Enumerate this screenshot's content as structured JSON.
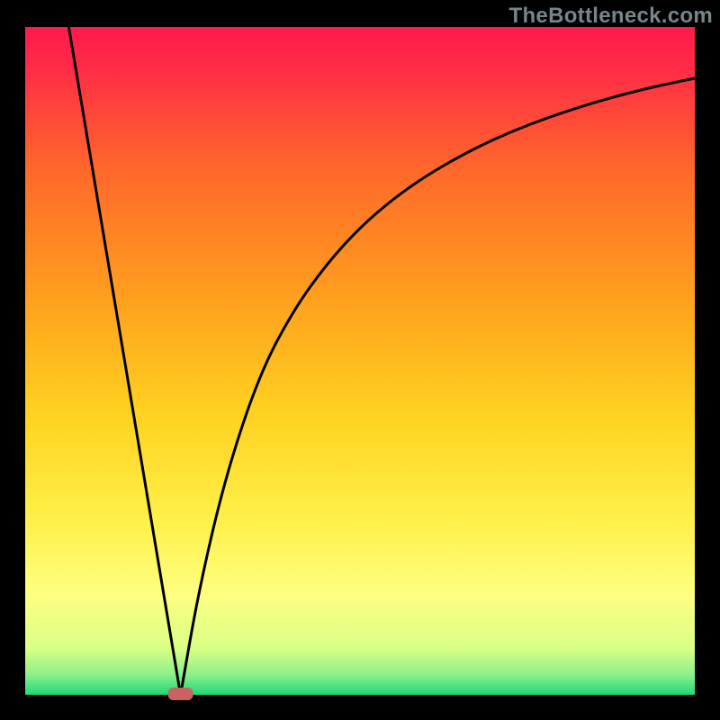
{
  "watermark": "TheBottleneck.com",
  "chart_data": {
    "type": "line",
    "title": "",
    "xlabel": "",
    "ylabel": "",
    "xlim": [
      0,
      100
    ],
    "ylim": [
      0,
      100
    ],
    "series": [
      {
        "name": "left-branch",
        "x": [
          6.5,
          23.2
        ],
        "y": [
          100,
          0
        ]
      },
      {
        "name": "right-branch",
        "x": [
          23.2,
          26,
          30,
          35,
          40,
          45,
          50,
          55,
          60,
          65,
          70,
          75,
          80,
          85,
          90,
          95,
          100
        ],
        "y": [
          0,
          16,
          33,
          48,
          57.5,
          64.5,
          70,
          74.3,
          77.8,
          80.7,
          83.2,
          85.3,
          87.1,
          88.7,
          90.1,
          91.3,
          92.3
        ]
      }
    ],
    "annotations": [
      {
        "name": "vertex-marker",
        "x": 23.2,
        "y": 0,
        "shape": "rounded-rect",
        "color": "#c96263"
      }
    ],
    "background_gradient": {
      "top": "#ff1a4b",
      "middle_top": "#ff7a1f",
      "middle": "#ffd21f",
      "middle_bottom": "#ffff6e",
      "bottom": "#27e07b"
    },
    "frame_color": "#000000"
  }
}
